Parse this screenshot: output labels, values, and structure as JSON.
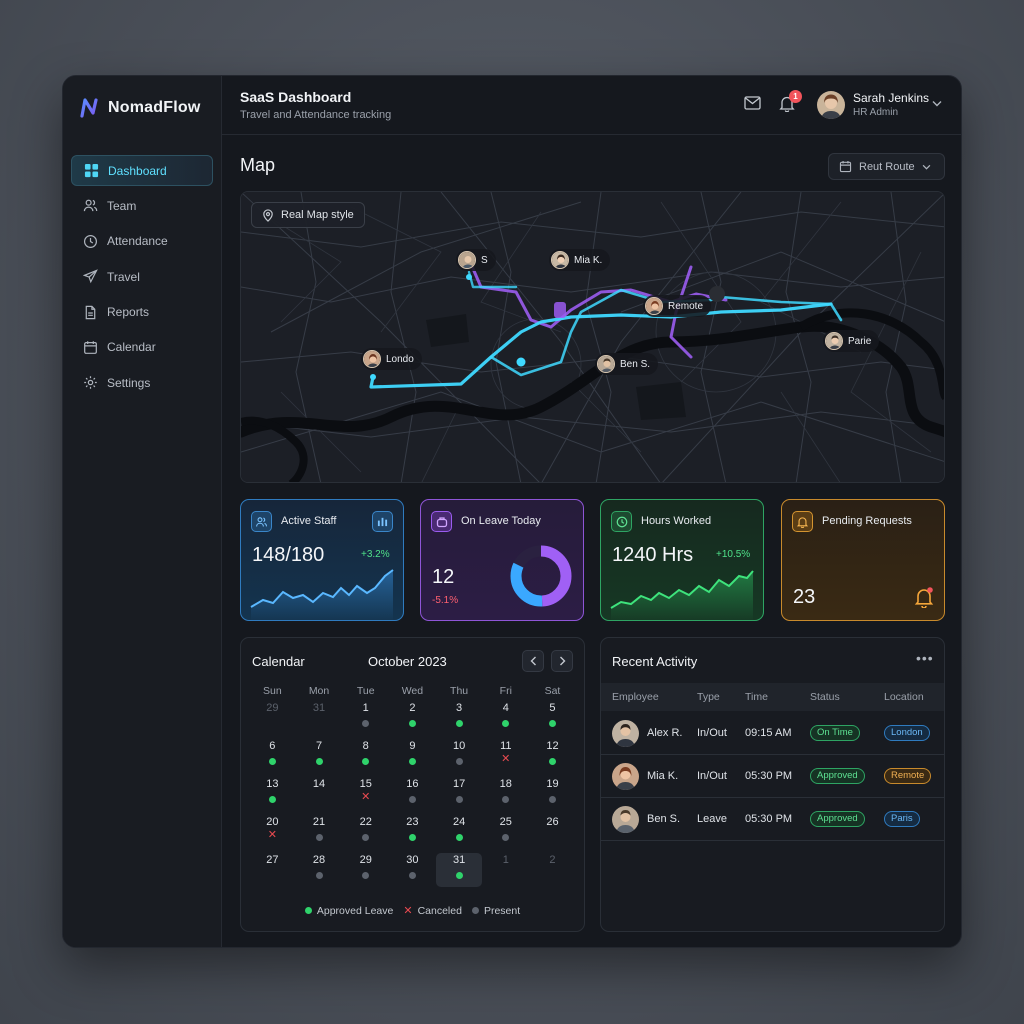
{
  "brand": {
    "name": "NomadFlow"
  },
  "nav": [
    {
      "label": "Dashboard",
      "icon": "grid-icon",
      "active": true
    },
    {
      "label": "Team",
      "icon": "users-icon"
    },
    {
      "label": "Attendance",
      "icon": "clock-icon"
    },
    {
      "label": "Travel",
      "icon": "plane-icon"
    },
    {
      "label": "Reports",
      "icon": "document-icon"
    },
    {
      "label": "Calendar",
      "icon": "calendar-icon"
    },
    {
      "label": "Settings",
      "icon": "gear-icon"
    }
  ],
  "header": {
    "title": "SaaS Dashboard",
    "subtitle": "Travel and Attendance tracking",
    "notification_count": "1",
    "user_name": "Sarah Jenkins",
    "user_role": "HR Admin"
  },
  "map": {
    "title": "Map",
    "route_button": "Reut Route",
    "style_button": "Real Map style",
    "pins": {
      "s": "S",
      "mia": "Mia K.",
      "remote": "Remote",
      "londo": "Londo",
      "ben": "Ben S.",
      "parie": "Parie"
    }
  },
  "stats": {
    "active_staff": {
      "label": "Active Staff",
      "value": "148/180",
      "delta": "+3.2%"
    },
    "on_leave": {
      "label": "On Leave Today",
      "value": "12",
      "delta": "-5.1%",
      "ring_fraction": 0.82
    },
    "hours_worked": {
      "label": "Hours Worked",
      "value": "1240 Hrs",
      "delta": "+10.5%"
    },
    "pending": {
      "label": "Pending Requests",
      "value": "23"
    }
  },
  "calendar": {
    "title": "Calendar",
    "month": "October 2023",
    "weekdays": [
      "Sun",
      "Mon",
      "Tue",
      "Wed",
      "Thu",
      "Fri",
      "Sat"
    ],
    "weeks": [
      [
        {
          "d": "29",
          "m": true
        },
        {
          "d": "31",
          "m": true
        },
        {
          "d": "1",
          "s": "p"
        },
        {
          "d": "2",
          "s": "g"
        },
        {
          "d": "3",
          "s": "g"
        },
        {
          "d": "4",
          "s": "g"
        },
        {
          "d": "5",
          "s": "g"
        }
      ],
      [
        {
          "d": "6",
          "s": "g"
        },
        {
          "d": "7",
          "s": "g"
        },
        {
          "d": "8",
          "s": "g"
        },
        {
          "d": "9",
          "s": "g"
        },
        {
          "d": "10",
          "s": "p"
        },
        {
          "d": "11",
          "s": "x"
        },
        {
          "d": "12",
          "s": "g"
        }
      ],
      [
        {
          "d": "13",
          "s": "g"
        },
        {
          "d": "14"
        },
        {
          "d": "15",
          "s": "x"
        },
        {
          "d": "16",
          "s": "p"
        },
        {
          "d": "17",
          "s": "p"
        },
        {
          "d": "18",
          "s": "p"
        },
        {
          "d": "19",
          "s": "p"
        }
      ],
      [
        {
          "d": "20",
          "s": "x"
        },
        {
          "d": "21",
          "s": "p"
        },
        {
          "d": "22",
          "s": "p"
        },
        {
          "d": "23",
          "s": "g"
        },
        {
          "d": "24",
          "s": "g"
        },
        {
          "d": "25",
          "s": "p"
        },
        {
          "d": "26"
        }
      ],
      [
        {
          "d": "27"
        },
        {
          "d": "28",
          "s": "p"
        },
        {
          "d": "29",
          "s": "p"
        },
        {
          "d": "30",
          "s": "p"
        },
        {
          "d": "31",
          "s": "g",
          "sel": true
        },
        {
          "d": "1",
          "m": true
        },
        {
          "d": "2",
          "m": true
        }
      ]
    ],
    "legend": {
      "approved": "Approved Leave",
      "canceled": "Canceled",
      "present": "Present"
    }
  },
  "activity": {
    "title": "Recent Activity",
    "columns": [
      "Employee",
      "Type",
      "Time",
      "Status",
      "Location"
    ],
    "rows": [
      {
        "employee": "Alex R.",
        "type": "In/Out",
        "time": "09:15 AM",
        "status": "On Time",
        "location": "London",
        "loc_color": "blue"
      },
      {
        "employee": "Mia K.",
        "type": "In/Out",
        "time": "05:30 PM",
        "status": "Approved",
        "location": "Remote",
        "loc_color": "orange"
      },
      {
        "employee": "Ben S.",
        "type": "Leave",
        "time": "05:30 PM",
        "status": "Approved",
        "location": "Paris",
        "loc_color": "blue"
      }
    ]
  },
  "colors": {
    "accent": "#5fe0ff",
    "route_cyan": "#3fd9ff",
    "route_purple": "#9b5cf0",
    "success": "#2fd36b",
    "danger": "#e84a50"
  }
}
